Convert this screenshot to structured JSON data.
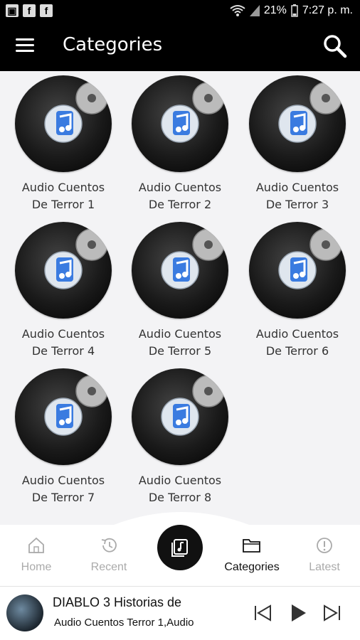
{
  "status_bar": {
    "notification_icons": [
      "image-icon",
      "facebook-icon",
      "facebook-icon"
    ],
    "battery_percent": "21%",
    "time": "7:27 p. m."
  },
  "app_bar": {
    "title": "Categories",
    "menu_icon": "hamburger-menu-icon",
    "search_icon": "search-icon"
  },
  "categories": [
    {
      "line1": "Audio Cuentos",
      "line2": "De Terror 1"
    },
    {
      "line1": "Audio Cuentos",
      "line2": "De Terror 2"
    },
    {
      "line1": "Audio Cuentos",
      "line2": "De Terror 3"
    },
    {
      "line1": "Audio Cuentos",
      "line2": "De Terror 4"
    },
    {
      "line1": "Audio Cuentos",
      "line2": "De Terror 5"
    },
    {
      "line1": "Audio Cuentos",
      "line2": "De Terror 6"
    },
    {
      "line1": "Audio Cuentos",
      "line2": "De Terror 7"
    },
    {
      "line1": "Audio Cuentos",
      "line2": "De Terror 8"
    }
  ],
  "bottom_nav": {
    "items": [
      {
        "label": "Home",
        "icon": "home-icon"
      },
      {
        "label": "Recent",
        "icon": "history-icon"
      },
      {
        "label": "Categories",
        "icon": "folder-icon"
      },
      {
        "label": "Latest",
        "icon": "alert-circle-icon"
      }
    ],
    "active": "Categories",
    "center_icon": "music-library-icon"
  },
  "player": {
    "title": "DIABLO          3 Historias de",
    "subtitle": "Audio Cuentos Terror 1,Audio",
    "controls": [
      "skip-previous-icon",
      "play-icon",
      "skip-next-icon"
    ]
  },
  "colors": {
    "app_bar": "#000000",
    "background": "#f3f3f5",
    "active_nav": "#111111",
    "inactive_nav": "#aaaaaa"
  }
}
